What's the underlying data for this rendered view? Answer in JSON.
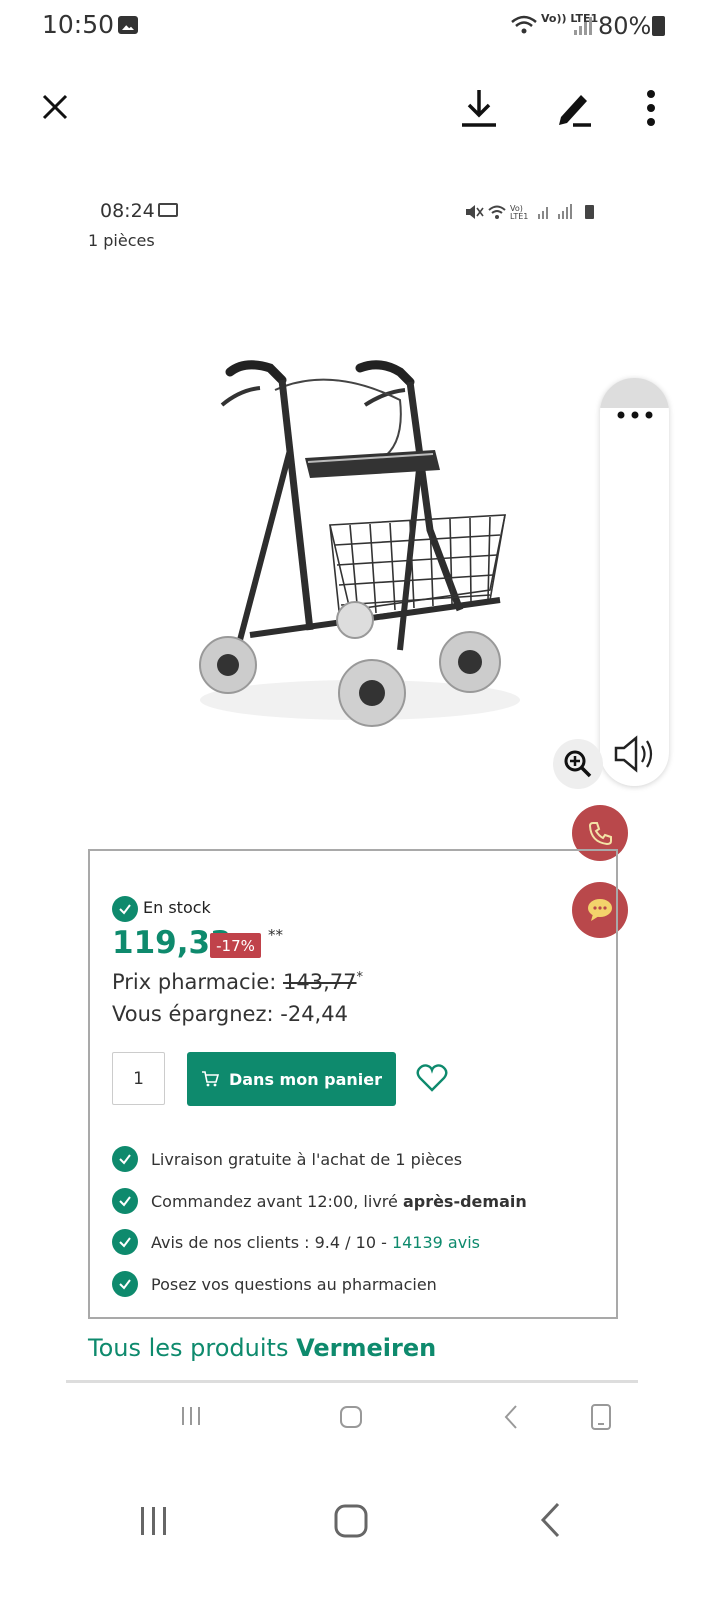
{
  "status_bar": {
    "time": "10:50",
    "battery": "80%",
    "network": "Vo)) LTE1"
  },
  "toolbar": {
    "close": "close-icon",
    "download": "download-icon",
    "edit": "edit-icon",
    "more": "more-icon"
  },
  "inner_status": {
    "time": "08:24",
    "subtitle": "1 pièces"
  },
  "product": {
    "stock": "En stock",
    "price": "119,33",
    "discount": "-17%",
    "footnote": "**",
    "pharmacy_label": "Prix pharmacie:",
    "pharmacy_price": "143,77",
    "pharmacy_mark": "*",
    "savings_label": "Vous épargnez:",
    "savings_value": "-24,44",
    "quantity": "1",
    "cart_label": "Dans mon panier",
    "features": [
      {
        "text": "Livraison gratuite à l'achat de 1 pièces"
      },
      {
        "text": "Commandez avant 12:00, livré ",
        "bold": "après-demain"
      },
      {
        "text": "Avis de nos clients : 9.4 / 10 - ",
        "link": "14139 avis"
      },
      {
        "text": "Posez vos questions au pharmacien"
      }
    ],
    "brand_prefix": "Tous les produits ",
    "brand_name": "Vermeiren"
  },
  "colors": {
    "brand_green": "#0e8a6d",
    "badge_red": "#c0424a",
    "fab_red": "#b9484b"
  }
}
